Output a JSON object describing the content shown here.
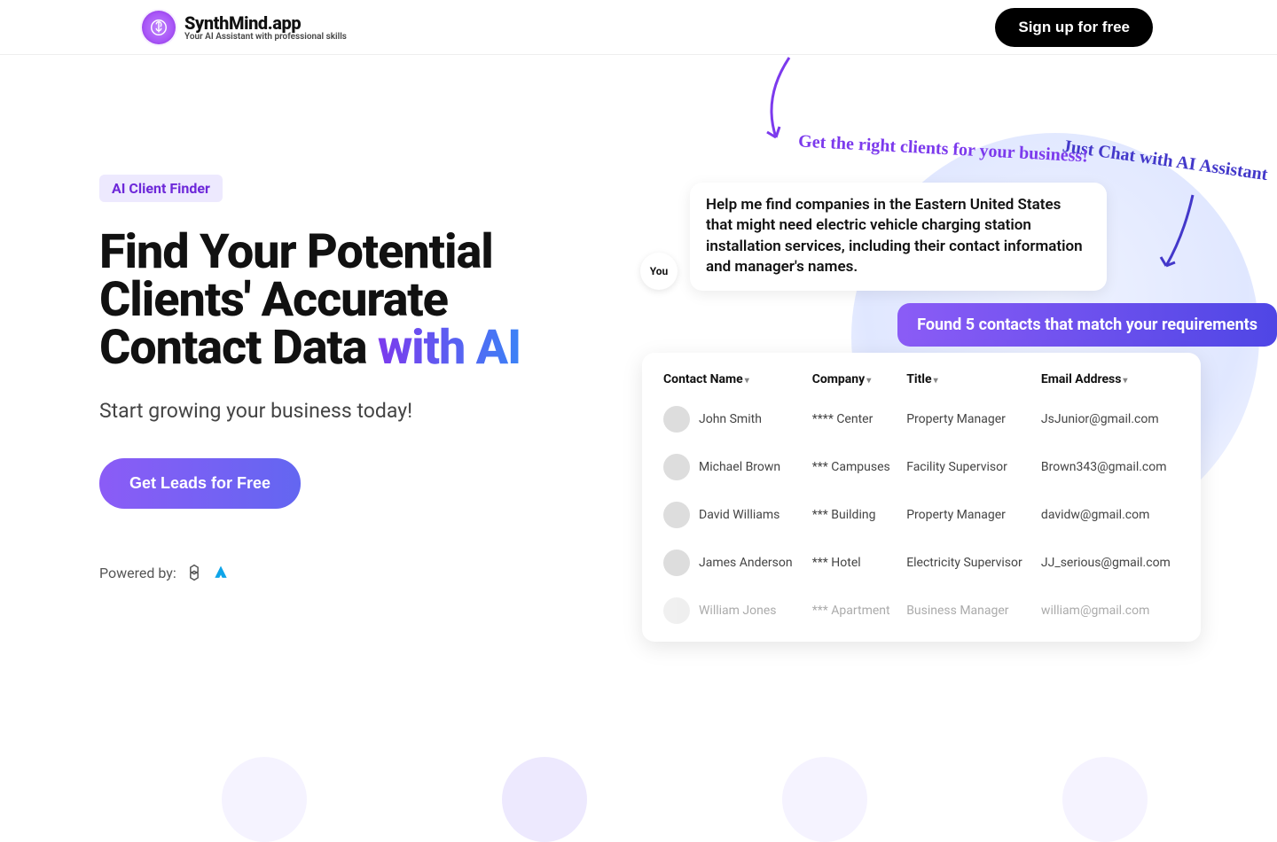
{
  "header": {
    "logo_title": "SynthMind.app",
    "logo_tagline": "Your AI Assistant with professional skills",
    "signup_label": "Sign up for free"
  },
  "hero": {
    "badge": "AI Client Finder",
    "headline_pre": "Find Your Potential Clients' Accurate Contact Data ",
    "headline_accent": "with AI",
    "subhead": "Start growing your business today!",
    "cta_label": "Get Leads for Free",
    "powered_label": "Powered by:"
  },
  "illustration": {
    "you_label": "You",
    "user_message": "Help me find companies in the Eastern United States that might need electric vehicle charging station installation services, including their contact information and manager's names.",
    "ai_response": "Found 5 contacts that match your requirements",
    "handwriting_top": "Just Chat with AI Assistant",
    "handwriting_bottom": "Get the right clients for your business!",
    "columns": {
      "name": "Contact Name",
      "company": "Company",
      "title": "Title",
      "email": "Email Address"
    },
    "rows": [
      {
        "name": "John Smith",
        "company": "**** Center",
        "title": "Property Manager",
        "email": "JsJunior@gmail.com",
        "faded": false
      },
      {
        "name": "Michael Brown",
        "company": "*** Campuses",
        "title": "Facility Supervisor",
        "email": "Brown343@gmail.com",
        "faded": false
      },
      {
        "name": "David Williams",
        "company": "*** Building",
        "title": "Property Manager",
        "email": "davidw@gmail.com",
        "faded": false
      },
      {
        "name": "James Anderson",
        "company": "*** Hotel",
        "title": "Electricity Supervisor",
        "email": "JJ_serious@gmail.com",
        "faded": false
      },
      {
        "name": "William Jones",
        "company": "*** Apartment",
        "title": "Business Manager",
        "email": "william@gmail.com",
        "faded": true
      }
    ]
  }
}
